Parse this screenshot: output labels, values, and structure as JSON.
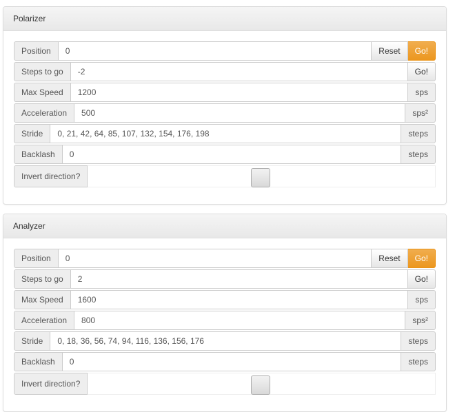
{
  "panels": [
    {
      "title": "Polarizer",
      "position": {
        "label": "Position",
        "value": "0",
        "reset_label": "Reset",
        "go_label": "Go!"
      },
      "steps": {
        "label": "Steps to go",
        "value": "-2",
        "go_label": "Go!"
      },
      "max_speed": {
        "label": "Max Speed",
        "value": "1200",
        "unit": "sps"
      },
      "acceleration": {
        "label": "Acceleration",
        "value": "500",
        "unit": "sps²"
      },
      "stride": {
        "label": "Stride",
        "value": "0, 21, 42, 64, 85, 107, 132, 154, 176, 198",
        "unit": "steps"
      },
      "backlash": {
        "label": "Backlash",
        "value": "0",
        "unit": "steps"
      },
      "invert": {
        "label": "Invert direction?",
        "checked": false
      }
    },
    {
      "title": "Analyzer",
      "position": {
        "label": "Position",
        "value": "0",
        "reset_label": "Reset",
        "go_label": "Go!"
      },
      "steps": {
        "label": "Steps to go",
        "value": "2",
        "go_label": "Go!"
      },
      "max_speed": {
        "label": "Max Speed",
        "value": "1600",
        "unit": "sps"
      },
      "acceleration": {
        "label": "Acceleration",
        "value": "800",
        "unit": "sps²"
      },
      "stride": {
        "label": "Stride",
        "value": "0, 18, 36, 56, 74, 94, 116, 136, 156, 176",
        "unit": "steps"
      },
      "backlash": {
        "label": "Backlash",
        "value": "0",
        "unit": "steps"
      },
      "invert": {
        "label": "Invert direction?",
        "checked": false
      }
    }
  ],
  "colors": {
    "go_primary": "#f0ad4e",
    "heading_bg": "#f5f5f5",
    "addon_bg": "#eeeeee"
  }
}
